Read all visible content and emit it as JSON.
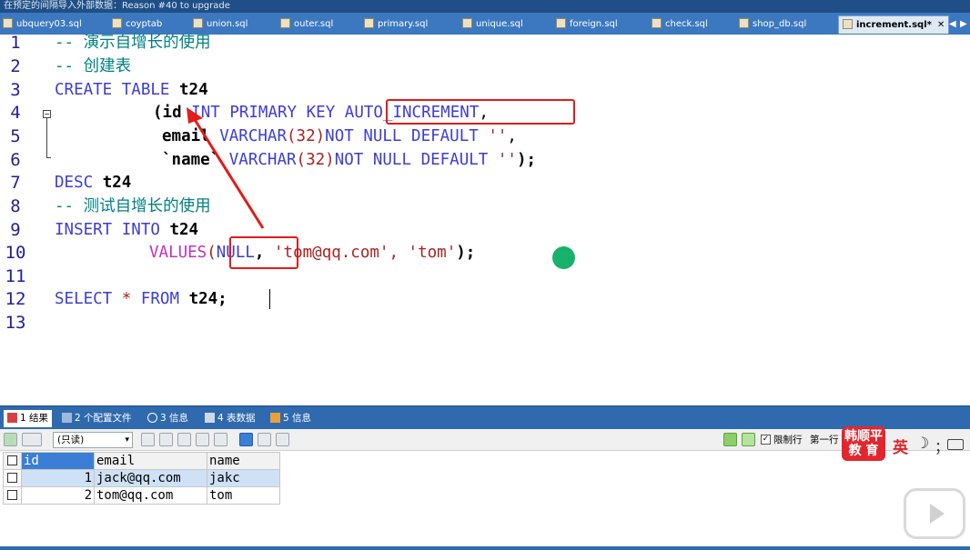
{
  "window": {
    "title": "在预定的间隔导入外部数据：Reason #40 to upgrade"
  },
  "tabs": [
    {
      "label": "ubquery03.sql"
    },
    {
      "label": "coyptab"
    },
    {
      "label": "union.sql"
    },
    {
      "label": "outer.sql"
    },
    {
      "label": "primary.sql"
    },
    {
      "label": "unique.sql"
    },
    {
      "label": "foreign.sql"
    },
    {
      "label": "check.sql"
    },
    {
      "label": "shop_db.sql"
    },
    {
      "label": "increment.sql*",
      "active": true
    }
  ],
  "tab_close": "✕",
  "tab_scroll_left": "◀",
  "tab_scroll_right": "▶",
  "editor": {
    "line_numbers": [
      "1",
      "2",
      "3",
      "4",
      "5",
      "6",
      "7",
      "8",
      "9",
      "10",
      "11",
      "12",
      "13"
    ],
    "lines": {
      "l1": {
        "comment": "-- 演示自增长的使用"
      },
      "l2": {
        "comment": "-- 创建表"
      },
      "l3": {
        "kw1": "CREATE",
        "kw2": "TABLE",
        "name": "t24"
      },
      "l4": {
        "paren": "(",
        "col": "id",
        "type": "INT",
        "kw1": "PRIMARY",
        "kw2": "KEY",
        "kw3": "AUTO_INCREMENT",
        "comma": ","
      },
      "l5": {
        "col": "email",
        "type": "VARCHAR",
        "paren_open": "(",
        "size": "32",
        "paren_close": ")",
        "kw1": "NOT",
        "kw2": "NULL",
        "kw3": "DEFAULT",
        "str": "''",
        "comma": ","
      },
      "l6": {
        "col": "`name`",
        "type": "VARCHAR",
        "paren_open": "(",
        "size": "32",
        "paren_close": ")",
        "kw1": "NOT",
        "kw2": "NULL",
        "kw3": "DEFAULT",
        "str": "''",
        "end": ");"
      },
      "l7": {
        "kw": "DESC",
        "name": "t24"
      },
      "l8": {
        "comment": "-- 测试自增长的使用"
      },
      "l9": {
        "kw1": "INSERT",
        "kw2": "INTO",
        "name": "t24"
      },
      "l10": {
        "fn": "VALUES",
        "paren_open": "(",
        "null": "NULL",
        "comma": ",",
        "str1": "'tom@qq.com'",
        "comma2": ",",
        "str2": "'tom'",
        "end": ");"
      },
      "l12": {
        "kw1": "SELECT",
        "star": "*",
        "kw2": "FROM",
        "name": "t24",
        "end": ";"
      }
    },
    "fold_marker": "−"
  },
  "results": {
    "tabs": [
      {
        "num": "1",
        "label": "结果",
        "active": true
      },
      {
        "num": "2",
        "label": "个配置文件"
      },
      {
        "num": "3",
        "label": "信息"
      },
      {
        "num": "4",
        "label": "表数据"
      },
      {
        "num": "5",
        "label": "信息"
      }
    ],
    "mode_select": "(只读)",
    "mode_arrow": "▾",
    "limit_checkbox": "✓",
    "limit_label": "限制行",
    "first_row_label": "第一行",
    "columns": [
      "id",
      "email",
      "name"
    ],
    "rows": [
      {
        "id": "1",
        "email": "jack@qq.com",
        "name": "jakc",
        "highlight": true
      },
      {
        "id": "2",
        "email": "tom@qq.com",
        "name": "tom"
      }
    ]
  },
  "overlay": {
    "logo_line1": "韩顺平",
    "logo_line2": "教 育",
    "ime_lang": "英",
    "ime_moon": "☽",
    "ime_punct": "；"
  },
  "colors": {
    "keyword": "#3d3dd6",
    "comment": "#008080",
    "string": "#aa2222",
    "function": "#c030c0",
    "annotation_red": "#e21b1b",
    "selection_blue": "#3a7fd5",
    "tab_bar": "#3c78c0"
  }
}
